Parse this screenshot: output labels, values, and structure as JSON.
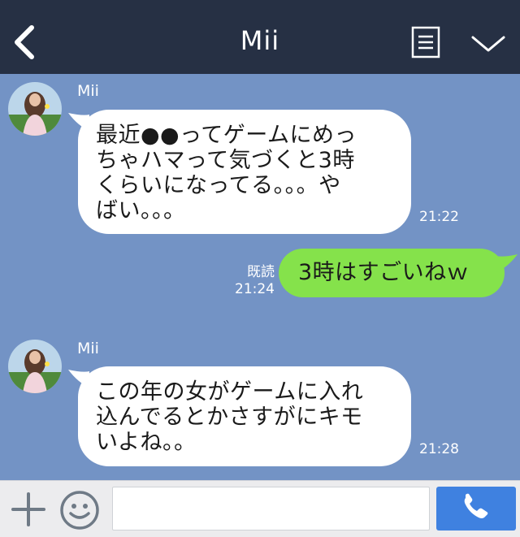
{
  "header": {
    "title": "Mii"
  },
  "messages": [
    {
      "direction": "incoming",
      "sender": "Mii",
      "text": "最近●●ってゲームにめっ\nちゃハマって気づくと3時\nくらいになってる。。。や\nばい。。。",
      "time": "21:22"
    },
    {
      "direction": "outgoing",
      "text": "3時はすごいねｗ",
      "read_label": "既読",
      "time": "21:24"
    },
    {
      "direction": "incoming",
      "sender": "Mii",
      "text": "この年の女がゲームに入れ\n込んでるとかさすがにキモ\nいよね。。",
      "time": "21:28"
    }
  ],
  "input": {
    "value": "",
    "placeholder": ""
  },
  "colors": {
    "header_bg": "#263044",
    "chat_bg": "#7393c5",
    "incoming_bubble": "#ffffff",
    "outgoing_bubble": "#85e24b",
    "call_button": "#3f81e0"
  },
  "icons": {
    "back": "chevron-left-icon",
    "notes": "notes-icon",
    "menu": "chevron-down-icon",
    "plus": "plus-icon",
    "emoji": "emoji-icon",
    "call": "phone-icon"
  }
}
